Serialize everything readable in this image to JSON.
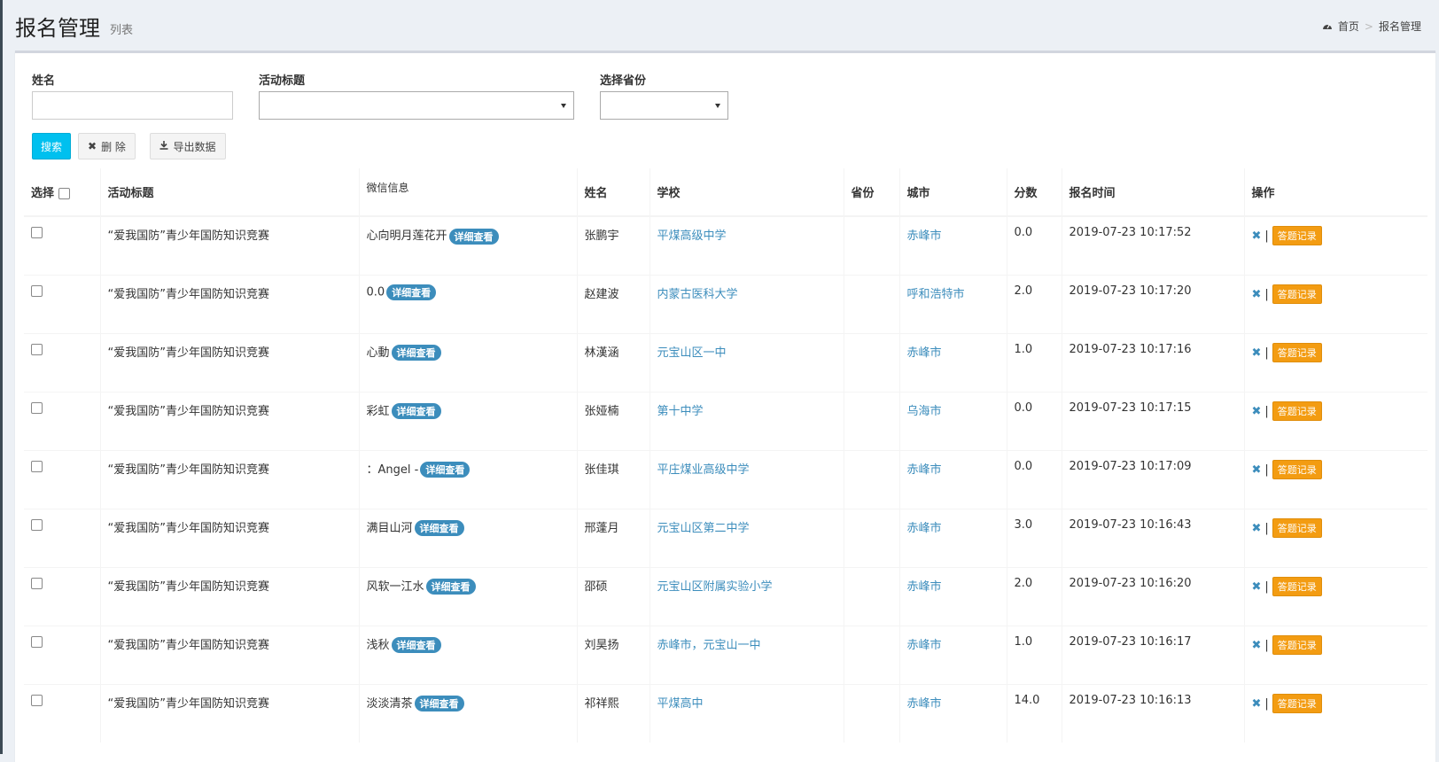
{
  "header": {
    "title": "报名管理",
    "subtitle": "列表",
    "breadcrumb": {
      "home": "首页",
      "current": "报名管理"
    }
  },
  "filters": {
    "name_label": "姓名",
    "name_value": "",
    "activity_label": "活动标题",
    "activity_value": "",
    "province_label": "选择省份",
    "province_value": ""
  },
  "toolbar": {
    "search_label": "搜索",
    "delete_label": "删 除",
    "export_label": "导出数据"
  },
  "table": {
    "headers": {
      "select": "选择",
      "activity": "活动标题",
      "wechat": "微信信息",
      "name": "姓名",
      "school": "学校",
      "province": "省份",
      "city": "城市",
      "score": "分数",
      "time": "报名时间",
      "ops": "操作"
    },
    "detail_label": "详细查看",
    "answer_label": "答题记录",
    "op_separator": "|",
    "rows": [
      {
        "activity": "“爱我国防”青少年国防知识竞赛",
        "wechat": "心向明月莲花开",
        "name": "张鹏宇",
        "school": "平煤高级中学",
        "province": "",
        "city": "赤峰市",
        "score": "0.0",
        "time": "2019-07-23 10:17:52"
      },
      {
        "activity": "“爱我国防”青少年国防知识竞赛",
        "wechat": "0.0",
        "name": "赵建波",
        "school": "内蒙古医科大学",
        "province": "",
        "city": "呼和浩特市",
        "score": "2.0",
        "time": "2019-07-23 10:17:20"
      },
      {
        "activity": "“爱我国防”青少年国防知识竞赛",
        "wechat": "心動",
        "name": "林漢涵",
        "school": "元宝山区一中",
        "province": "",
        "city": "赤峰市",
        "score": "1.0",
        "time": "2019-07-23 10:17:16"
      },
      {
        "activity": "“爱我国防”青少年国防知识竞赛",
        "wechat": "彩虹",
        "name": "张娅楠",
        "school": "第十中学",
        "province": "",
        "city": "乌海市",
        "score": "0.0",
        "time": "2019-07-23 10:17:15"
      },
      {
        "activity": "“爱我国防”青少年国防知识竞赛",
        "wechat": "：Angel -",
        "name": "张佳琪",
        "school": "平庄煤业高级中学",
        "province": "",
        "city": "赤峰市",
        "score": "0.0",
        "time": "2019-07-23 10:17:09"
      },
      {
        "activity": "“爱我国防”青少年国防知识竞赛",
        "wechat": "满目山河",
        "name": "邢蓬月",
        "school": "元宝山区第二中学",
        "province": "",
        "city": "赤峰市",
        "score": "3.0",
        "time": "2019-07-23 10:16:43"
      },
      {
        "activity": "“爱我国防”青少年国防知识竞赛",
        "wechat": "风软一江水",
        "name": "邵硕",
        "school": "元宝山区附属实验小学",
        "province": "",
        "city": "赤峰市",
        "score": "2.0",
        "time": "2019-07-23 10:16:20"
      },
      {
        "activity": "“爱我国防”青少年国防知识竞赛",
        "wechat": "浅秋",
        "name": "刘昊扬",
        "school": "赤峰市，元宝山一中",
        "province": "",
        "city": "赤峰市",
        "score": "1.0",
        "time": "2019-07-23 10:16:17"
      },
      {
        "activity": "“爱我国防”青少年国防知识竞赛",
        "wechat": "淡淡清茶",
        "name": "祁祥熙",
        "school": "平煤高中",
        "province": "",
        "city": "赤峰市",
        "score": "14.0",
        "time": "2019-07-23 10:16:13"
      }
    ]
  }
}
